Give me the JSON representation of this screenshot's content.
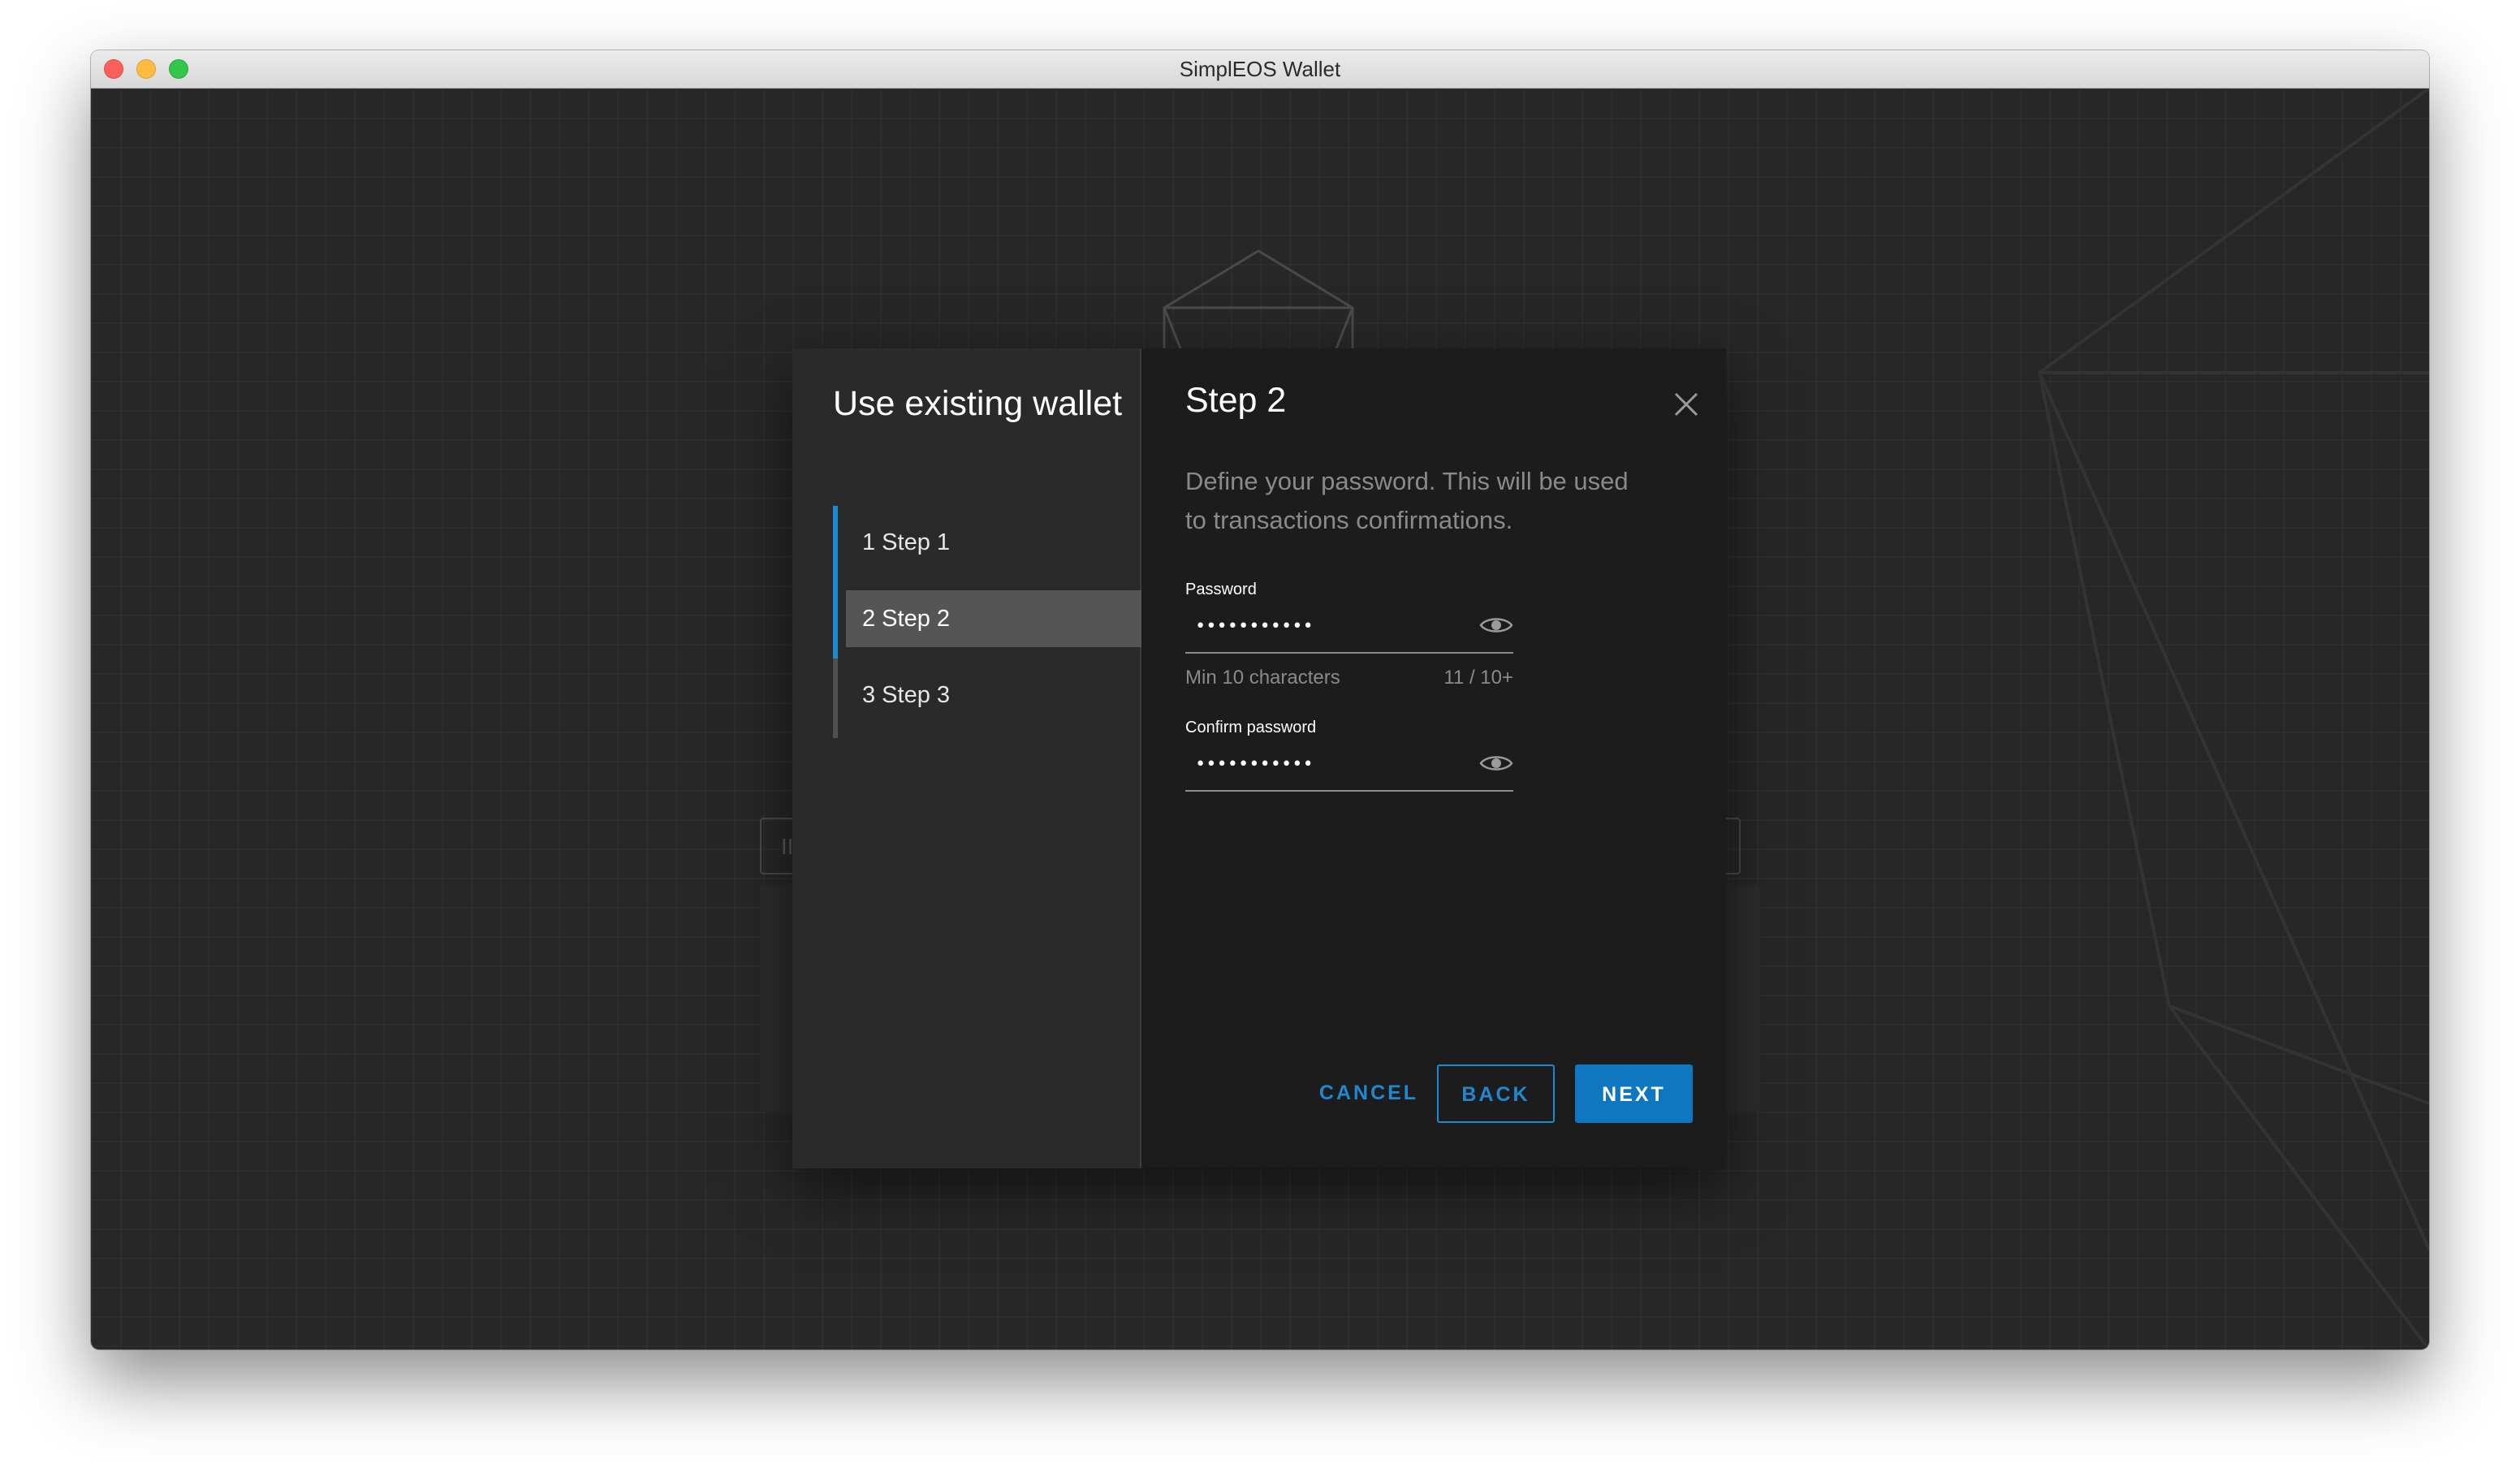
{
  "window": {
    "title": "SimplEOS Wallet"
  },
  "background": {
    "field_glyph": "II"
  },
  "sidebar": {
    "title": "Use existing wallet",
    "steps": [
      {
        "label": "1  Step 1"
      },
      {
        "label": "2  Step 2"
      },
      {
        "label": "3  Step 3"
      }
    ],
    "active_step": 2
  },
  "main": {
    "title": "Step 2",
    "description": "Define your password. This will be used to transactions confirmations.",
    "password": {
      "label": "Password",
      "value": "•••••••••••",
      "hint": "Min 10 characters",
      "counter": "11 / 10+"
    },
    "confirm_password": {
      "label": "Confirm password",
      "value": "•••••••••••"
    }
  },
  "buttons": {
    "cancel": "CANCEL",
    "back": "BACK",
    "next": "NEXT"
  },
  "colors": {
    "accent": "#1e88d0",
    "primary_button": "#0e77c0",
    "dialog_sidebar": "#2a2a2a",
    "dialog_main": "#1c1c1c",
    "app_background": "#272727"
  },
  "icons": {
    "close": "close-icon",
    "password_toggle": "eye-icon"
  }
}
